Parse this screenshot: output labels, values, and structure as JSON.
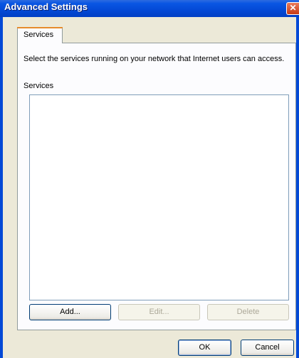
{
  "window": {
    "title": "Advanced Settings",
    "close_glyph": "✕"
  },
  "tabs": [
    {
      "label": "Services",
      "selected": true
    }
  ],
  "panel": {
    "description": "Select the services running on your network that Internet users can access.",
    "list_label": "Services",
    "list_items": []
  },
  "buttons": {
    "add": "Add...",
    "edit": "Edit...",
    "delete": "Delete",
    "ok": "OK",
    "cancel": "Cancel"
  },
  "colors": {
    "titlebar": "#0349d6",
    "dialog_bg": "#ece9d8",
    "tab_highlight": "#e68b2c"
  }
}
